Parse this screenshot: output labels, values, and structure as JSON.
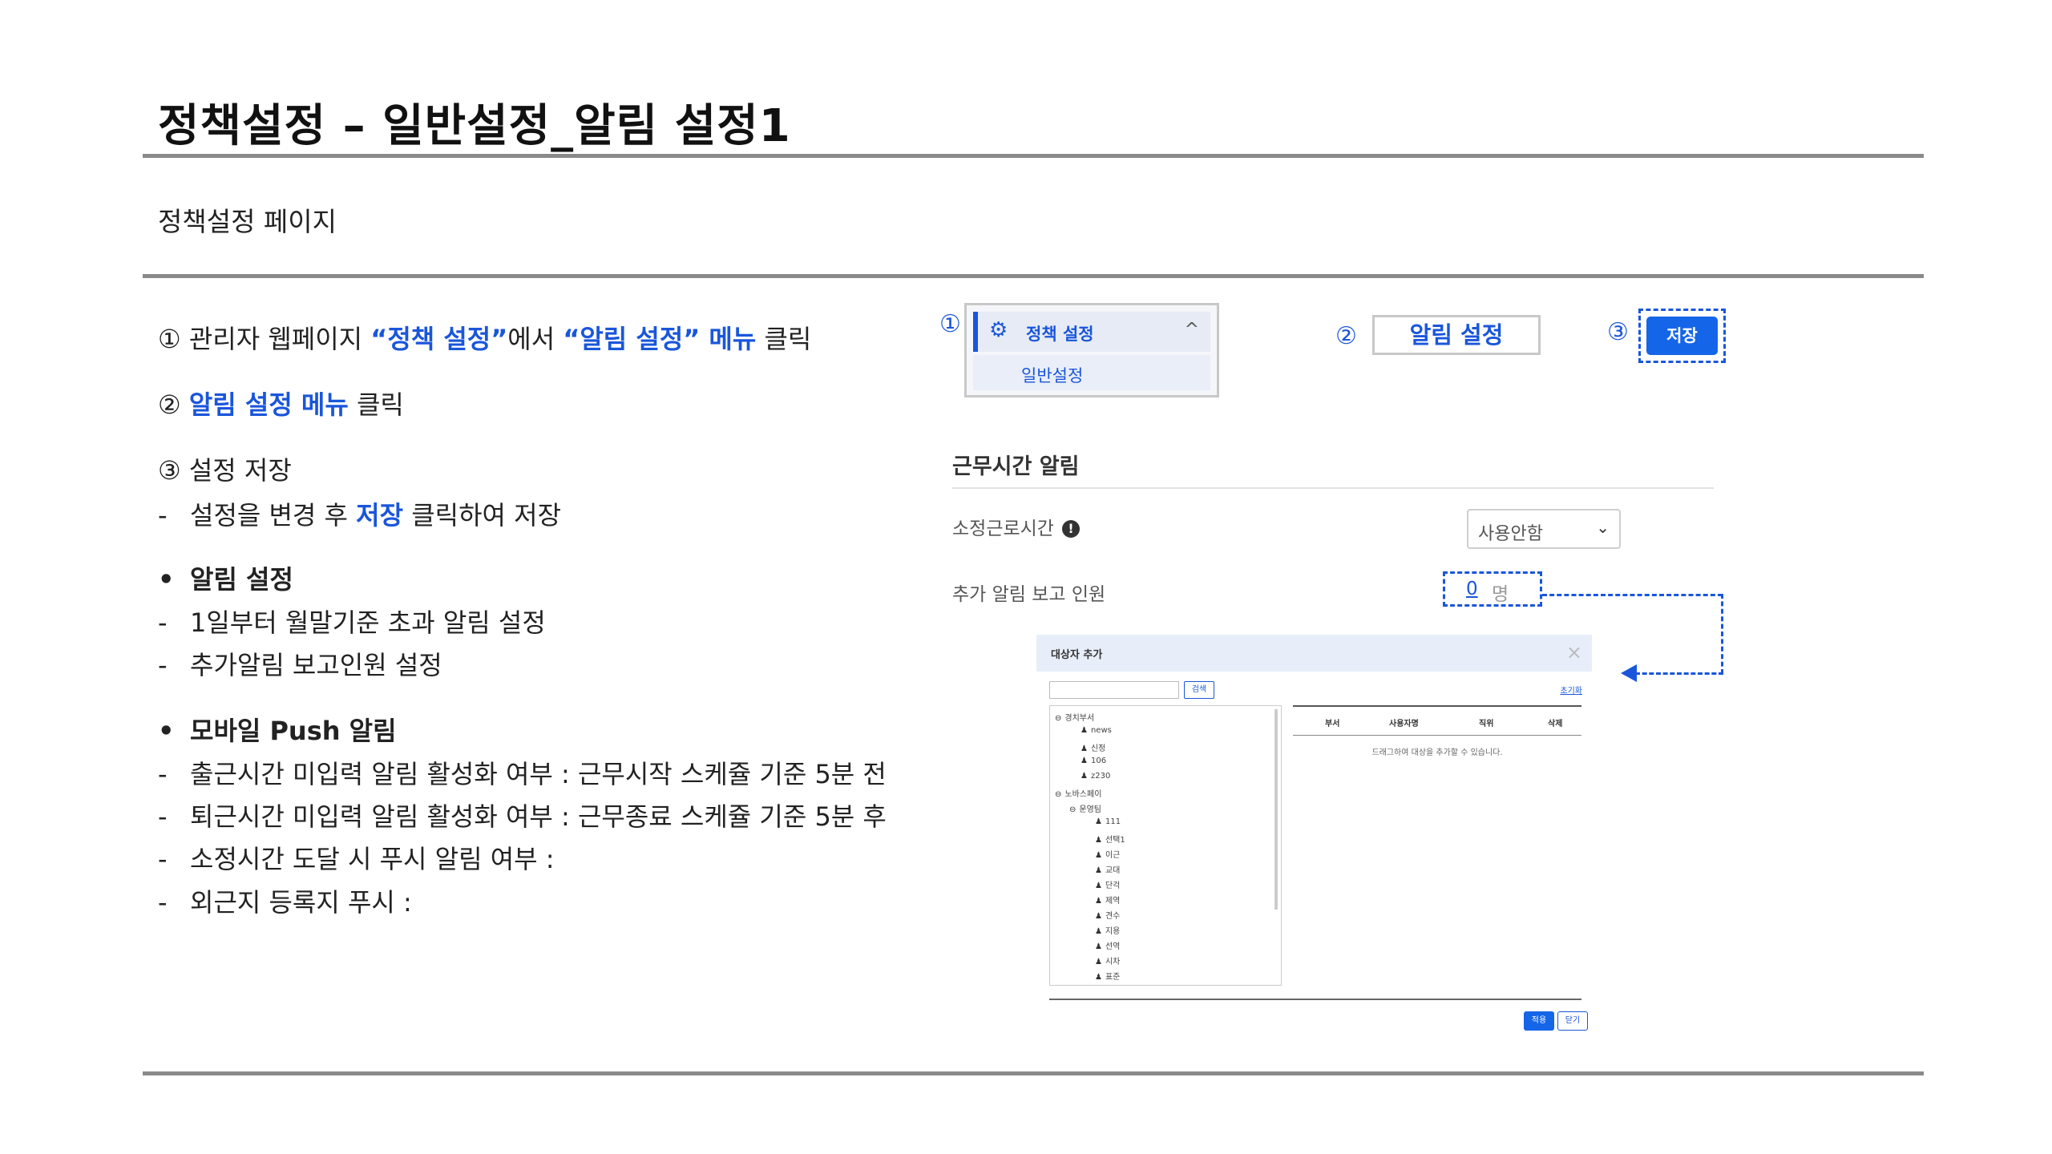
{
  "page": {
    "title": "정책설정 – 일반설정_알림 설정1",
    "subtitle": "정책설정 페이지"
  },
  "steps": {
    "s1_num": "①",
    "s1_a": "관리자 웹페이지 ",
    "s1_b": "“정책 설정”",
    "s1_c": "에서 ",
    "s1_d": "“알림 설정” 메뉴",
    "s1_e": " 클릭",
    "s2_num": "②",
    "s2_a": "알림 설정 메뉴",
    "s2_b": " 클릭",
    "s3_num": "③",
    "s3_a": "설정 저장",
    "s3_dash": "-",
    "s3_b": "설정을 변경 후 ",
    "s3_c": "저장",
    "s3_d": " 클릭하여 저장"
  },
  "bullets": [
    {
      "mark": "•",
      "title": "알림 설정",
      "items": [
        "1일부터 월말기준 초과 알림 설정",
        "추가알림 보고인원 설정"
      ]
    },
    {
      "mark": "•",
      "title": "모바일 Push 알림",
      "items": [
        "출근시간 미입력 알림 활성화 여부 : 근무시작 스케쥴 기준 5분 전",
        "퇴근시간 미입력 알림 활성화 여부 : 근무종료 스케쥴 기준 5분 후",
        "소정시간 도달 시 푸시 알림 여부 :",
        "외근지 등록지 푸시 :"
      ]
    }
  ],
  "dash": "-",
  "callouts": {
    "c1": "①",
    "c2": "②",
    "c3": "③"
  },
  "menu": {
    "gear_icon": "gear-icon",
    "policy_label": "정책 설정",
    "chevron": "^",
    "general_label": "일반설정"
  },
  "alarm_tab_label": "알림 설정",
  "save_label": "저장",
  "work_alarm": {
    "section_title": "근무시간 알림",
    "row1_label": "소정근로시간",
    "info_glyph": "!",
    "select_value": "사용안함",
    "select_arrow": "⌄",
    "row2_label": "추가 알림 보고 인원",
    "count_value": "0",
    "count_unit": "명"
  },
  "modal": {
    "title": "대상자 추가",
    "close": "×",
    "search_btn": "검색",
    "reset": "초기화",
    "tree": [
      "경치부서",
      "news",
      "신정",
      "106",
      "z230",
      "노바스페이",
      "운영팀",
      "111",
      "선택1",
      "이근",
      "교대",
      "단걱",
      "제역",
      "견수",
      "지용",
      "선역",
      "시차",
      "표준"
    ],
    "columns": [
      "부서",
      "사용자명",
      "직위",
      "삭제"
    ],
    "empty_text": "드래그하여 대상을 추가할 수 있습니다.",
    "apply": "적용",
    "close_btn": "닫기"
  },
  "colors": {
    "accent": "#1a56db",
    "button": "#1565e8",
    "rule": "#8a8a8a"
  }
}
